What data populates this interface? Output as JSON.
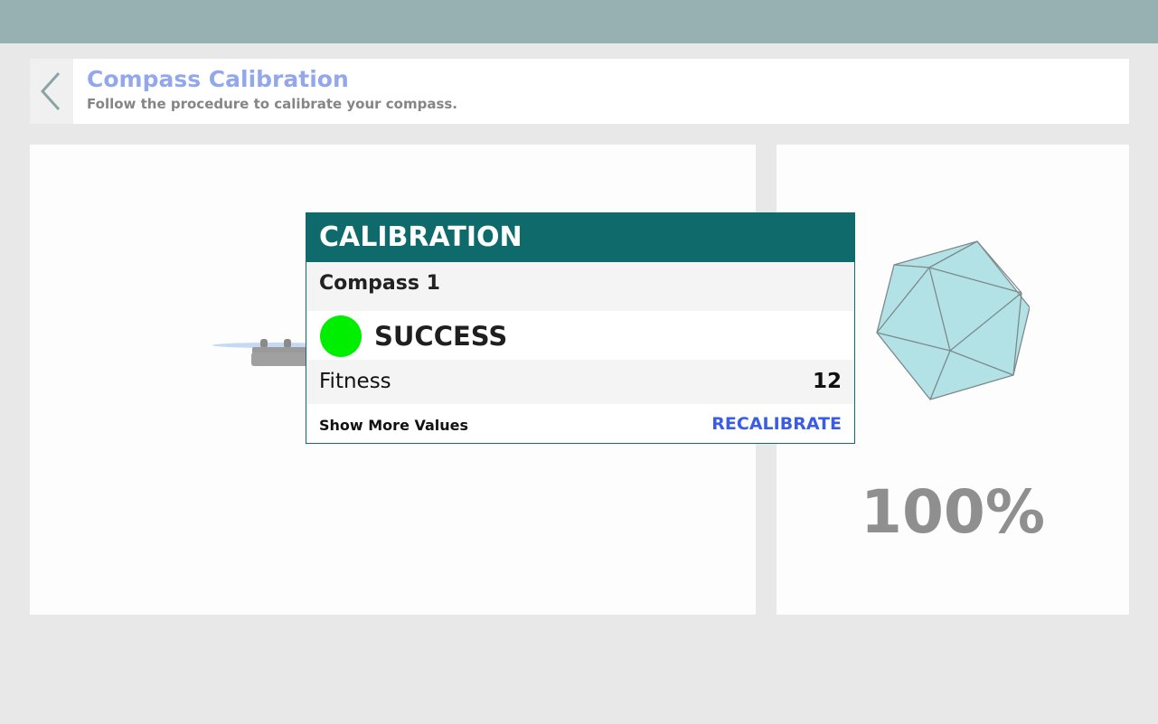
{
  "header": {
    "title": "Compass Calibration",
    "subtitle": "Follow the procedure to calibrate your compass."
  },
  "icons": {
    "back": "chevron-left-icon",
    "drone": "drone-icon",
    "sphere": "icosahedron-icon"
  },
  "progress": {
    "label": "100%",
    "value": 1.0
  },
  "modal": {
    "title": "CALIBRATION",
    "compass_label": "Compass 1",
    "status": "SUCCESS",
    "fitness_label": "Fitness",
    "fitness_value": "12",
    "show_more_label": "Show More Values",
    "recalibrate_label": "RECALIBRATE"
  },
  "colors": {
    "topbar": "#97b1b3",
    "accent_title": "#93a8ec",
    "modal_header": "#0f6a6b",
    "success": "#00ee00",
    "link": "#3b5ce4",
    "polyhedron_fill": "#b2e2e6"
  }
}
